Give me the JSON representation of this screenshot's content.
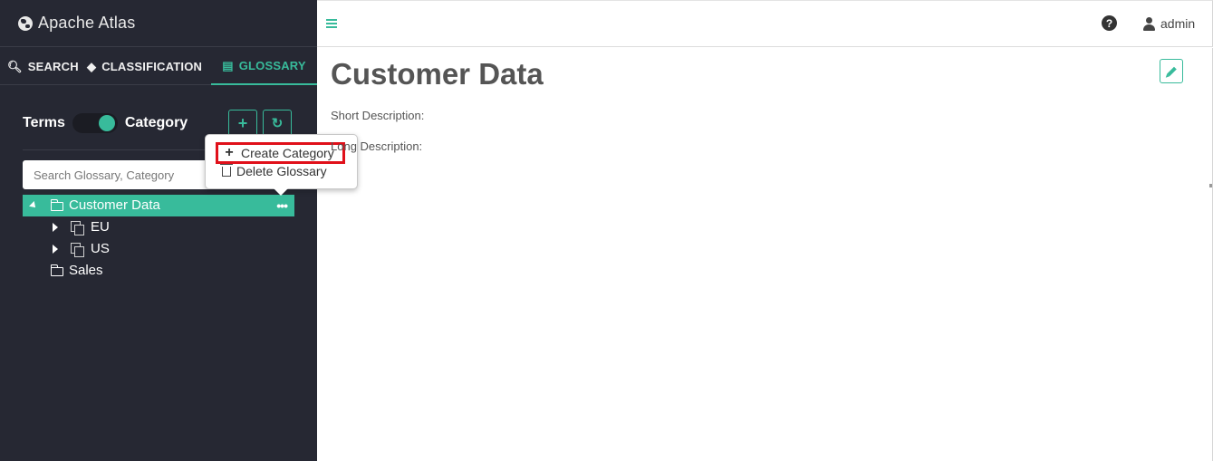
{
  "app": {
    "title": "Apache Atlas"
  },
  "tabs": [
    {
      "label": "SEARCH",
      "icon": "search-icon"
    },
    {
      "label": "CLASSIFICATION",
      "icon": "tags-icon"
    },
    {
      "label": "GLOSSARY",
      "icon": "folder-open-icon",
      "active": true
    }
  ],
  "toggle": {
    "left_label": "Terms",
    "right_label": "Category",
    "state": "Category"
  },
  "search": {
    "placeholder": "Search Glossary, Category"
  },
  "tree": {
    "items": [
      {
        "label": "Customer Data",
        "level": 0,
        "expanded": true,
        "selected": true,
        "icon": "folder-icon"
      },
      {
        "label": "EU",
        "level": 1,
        "expanded": false,
        "icon": "copy-icon"
      },
      {
        "label": "US",
        "level": 1,
        "expanded": false,
        "icon": "copy-icon"
      },
      {
        "label": "Sales",
        "level": 0,
        "icon": "folder-icon"
      }
    ]
  },
  "popover": {
    "items": [
      {
        "label": "Create Category",
        "icon": "plus-icon",
        "highlighted": true
      },
      {
        "label": "Delete Glossary",
        "icon": "trash-icon"
      }
    ]
  },
  "header": {
    "user": "admin"
  },
  "main": {
    "title": "Customer Data",
    "short_description_label": "Short Description:",
    "long_description_label": "Long Description:"
  },
  "colors": {
    "accent": "#38bb9b",
    "sidebar": "#262833",
    "highlight": "#e0101a"
  }
}
